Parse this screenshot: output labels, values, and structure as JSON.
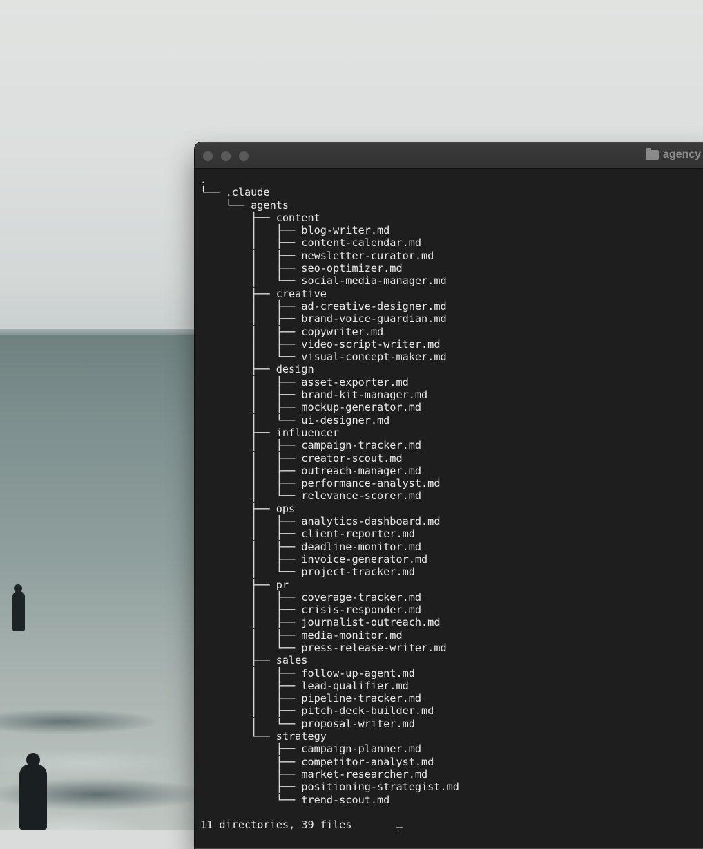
{
  "window": {
    "title": "agency"
  },
  "tree": {
    "lines": [
      ".",
      "└── .claude",
      "    └── agents",
      "        ├── content",
      "        │   ├── blog-writer.md",
      "        │   ├── content-calendar.md",
      "        │   ├── newsletter-curator.md",
      "        │   ├── seo-optimizer.md",
      "        │   └── social-media-manager.md",
      "        ├── creative",
      "        │   ├── ad-creative-designer.md",
      "        │   ├── brand-voice-guardian.md",
      "        │   ├── copywriter.md",
      "        │   ├── video-script-writer.md",
      "        │   └── visual-concept-maker.md",
      "        ├── design",
      "        │   ├── asset-exporter.md",
      "        │   ├── brand-kit-manager.md",
      "        │   ├── mockup-generator.md",
      "        │   └── ui-designer.md",
      "        ├── influencer",
      "        │   ├── campaign-tracker.md",
      "        │   ├── creator-scout.md",
      "        │   ├── outreach-manager.md",
      "        │   ├── performance-analyst.md",
      "        │   └── relevance-scorer.md",
      "        ├── ops",
      "        │   ├── analytics-dashboard.md",
      "        │   ├── client-reporter.md",
      "        │   ├── deadline-monitor.md",
      "        │   ├── invoice-generator.md",
      "        │   └── project-tracker.md",
      "        ├── pr",
      "        │   ├── coverage-tracker.md",
      "        │   ├── crisis-responder.md",
      "        │   ├── journalist-outreach.md",
      "        │   ├── media-monitor.md",
      "        │   └── press-release-writer.md",
      "        ├── sales",
      "        │   ├── follow-up-agent.md",
      "        │   ├── lead-qualifier.md",
      "        │   ├── pipeline-tracker.md",
      "        │   ├── pitch-deck-builder.md",
      "        │   └── proposal-writer.md",
      "        └── strategy",
      "            ├── campaign-planner.md",
      "            ├── competitor-analyst.md",
      "            ├── market-researcher.md",
      "            ├── positioning-strategist.md",
      "            └── trend-scout.md"
    ],
    "summary": "11 directories, 39 files"
  },
  "icons": {
    "title_icon": "folder-icon"
  }
}
